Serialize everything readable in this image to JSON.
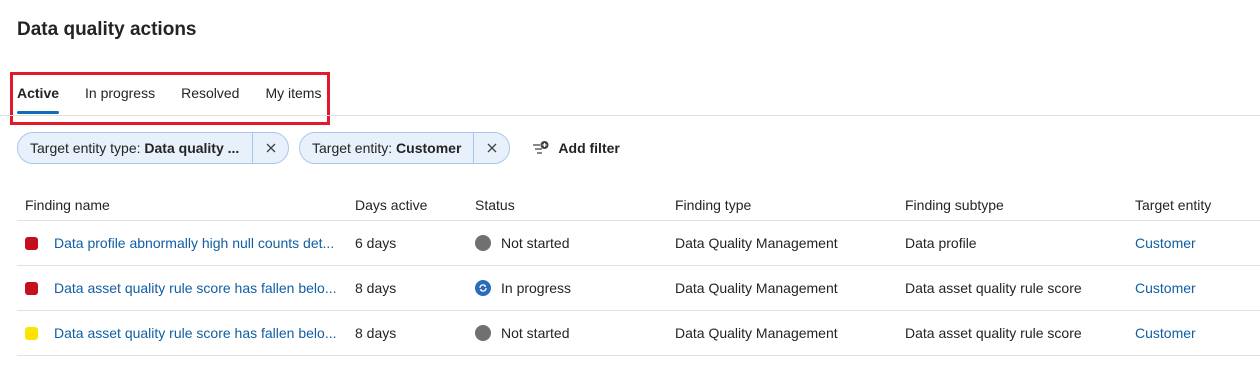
{
  "page": {
    "title": "Data quality actions"
  },
  "tabs": [
    {
      "label": "Active",
      "active": true
    },
    {
      "label": "In progress",
      "active": false
    },
    {
      "label": "Resolved",
      "active": false
    },
    {
      "label": "My items",
      "active": false
    }
  ],
  "filters": [
    {
      "prefix": "Target entity type: ",
      "value": "Data quality ..."
    },
    {
      "prefix": "Target entity: ",
      "value": "Customer"
    }
  ],
  "add_filter_label": "Add filter",
  "table": {
    "columns": [
      "Finding name",
      "Days active",
      "Status",
      "Finding type",
      "Finding subtype",
      "Target entity"
    ],
    "rows": [
      {
        "severity_color": "#c50f1f",
        "name": "Data profile abnormally high null counts det...",
        "days": "6 days",
        "status": "Not started",
        "status_icon": "not-started-icon",
        "type": "Data Quality Management",
        "subtype": "Data profile",
        "target": "Customer"
      },
      {
        "severity_color": "#c50f1f",
        "name": "Data asset quality rule score has fallen belo...",
        "days": "8 days",
        "status": "In progress",
        "status_icon": "in-progress-icon",
        "type": "Data Quality Management",
        "subtype": "Data asset quality rule score",
        "target": "Customer"
      },
      {
        "severity_color": "#fde300",
        "name": "Data asset quality rule score has fallen belo...",
        "days": "8 days",
        "status": "Not started",
        "status_icon": "not-started-icon",
        "type": "Data Quality Management",
        "subtype": "Data asset quality rule score",
        "target": "Customer"
      }
    ]
  },
  "colors": {
    "accent": "#0f6cbd",
    "link": "#115ea3",
    "highlight": "#e3192b",
    "not_started": "#707070",
    "in_progress": "#2b6cb8"
  }
}
